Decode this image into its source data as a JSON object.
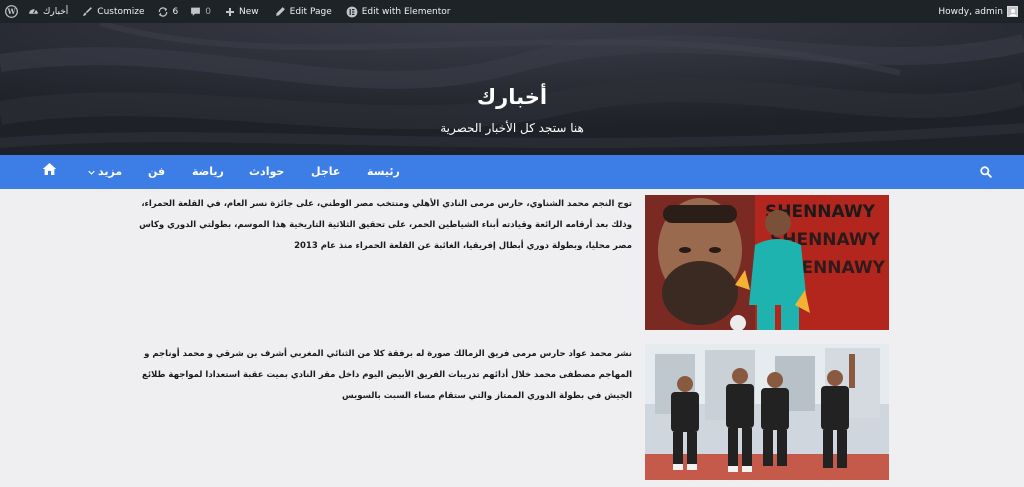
{
  "admin_bar": {
    "site_name": "أخبارك",
    "customize": "Customize",
    "updates_count": "6",
    "comments_count": "0",
    "new": "New",
    "edit_page": "Edit Page",
    "edit_elementor": "Edit with Elementor",
    "howdy": "Howdy, admin"
  },
  "header": {
    "site_title": "أخبارك",
    "tagline": "هنا ستجد كل الأخبار الحصرية"
  },
  "nav": {
    "items": [
      {
        "label": "رئيسة"
      },
      {
        "label": "عاجل"
      },
      {
        "label": "حوادث"
      },
      {
        "label": "رياضة"
      },
      {
        "label": "فن"
      },
      {
        "label": "مزيد"
      }
    ],
    "accent_color": "#3d7de6"
  },
  "posts": [
    {
      "text": "توج النجم محمد الشناوي، حارس مرمى النادي الأهلي ومنتخب مصر الوطني، على جائزة نسر العام، في القلعة الحمراء، وذلك بعد أرقامه الرائعة وقيادته أبناء الشياطين الحمر، على تحقيق الثلاثية التاريخية هذا الموسم، بطولتي الدوري وكاس مصر محليا، وبطولة دوري أبطال إفريقيا، الغائبة عن القلعة الحمراء منذ عام 2013",
      "image_text": "SHENNAWY"
    },
    {
      "text": "نشر محمد عواد حارس مرمى فريق الزمالك صورة له برفقة كلا من الثنائي المغربي أشرف بن شرقي و محمد أوناجم و المهاجم مصطفى محمد خلال أدائهم تدريبات الفريق الأبيض اليوم داخل مقر النادي بميت عقبة استعدادا لمواجهة طلائع الجيش في بطولة الدوري الممتاز والتي ستقام مساء السبت بالسويس"
    }
  ]
}
